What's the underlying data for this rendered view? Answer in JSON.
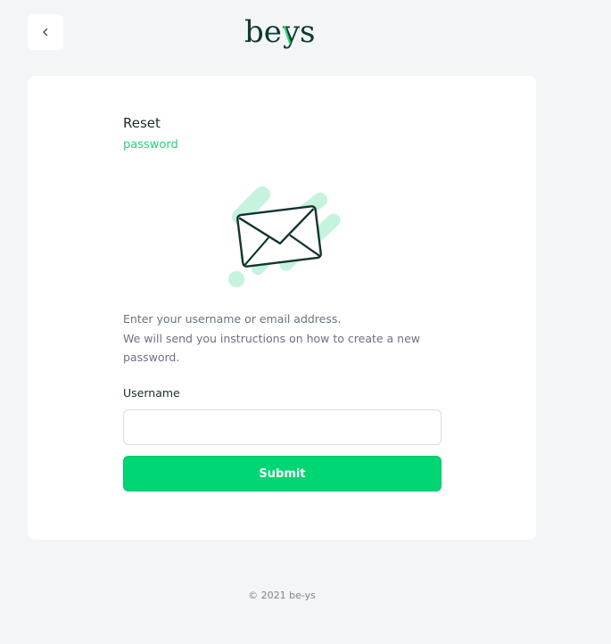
{
  "header": {
    "back_icon": "chevron-left-icon",
    "logo_text": "beys"
  },
  "card": {
    "title": "Reset",
    "subtitle": "password",
    "illustration_icon": "envelope-icon",
    "description_line1": "Enter your username or email address.",
    "description_line2": "We will send you instructions on how to create a new password.",
    "username_label": "Username",
    "username_value": "",
    "username_placeholder": "",
    "submit_label": "Submit"
  },
  "footer": {
    "copyright": "© 2021 be-ys"
  },
  "colors": {
    "accent": "#00d673",
    "accent_text": "#2bd37a",
    "brand_dark": "#0f3a33",
    "background": "#f3f5f6",
    "illustration_mint": "#c5f3dd"
  }
}
